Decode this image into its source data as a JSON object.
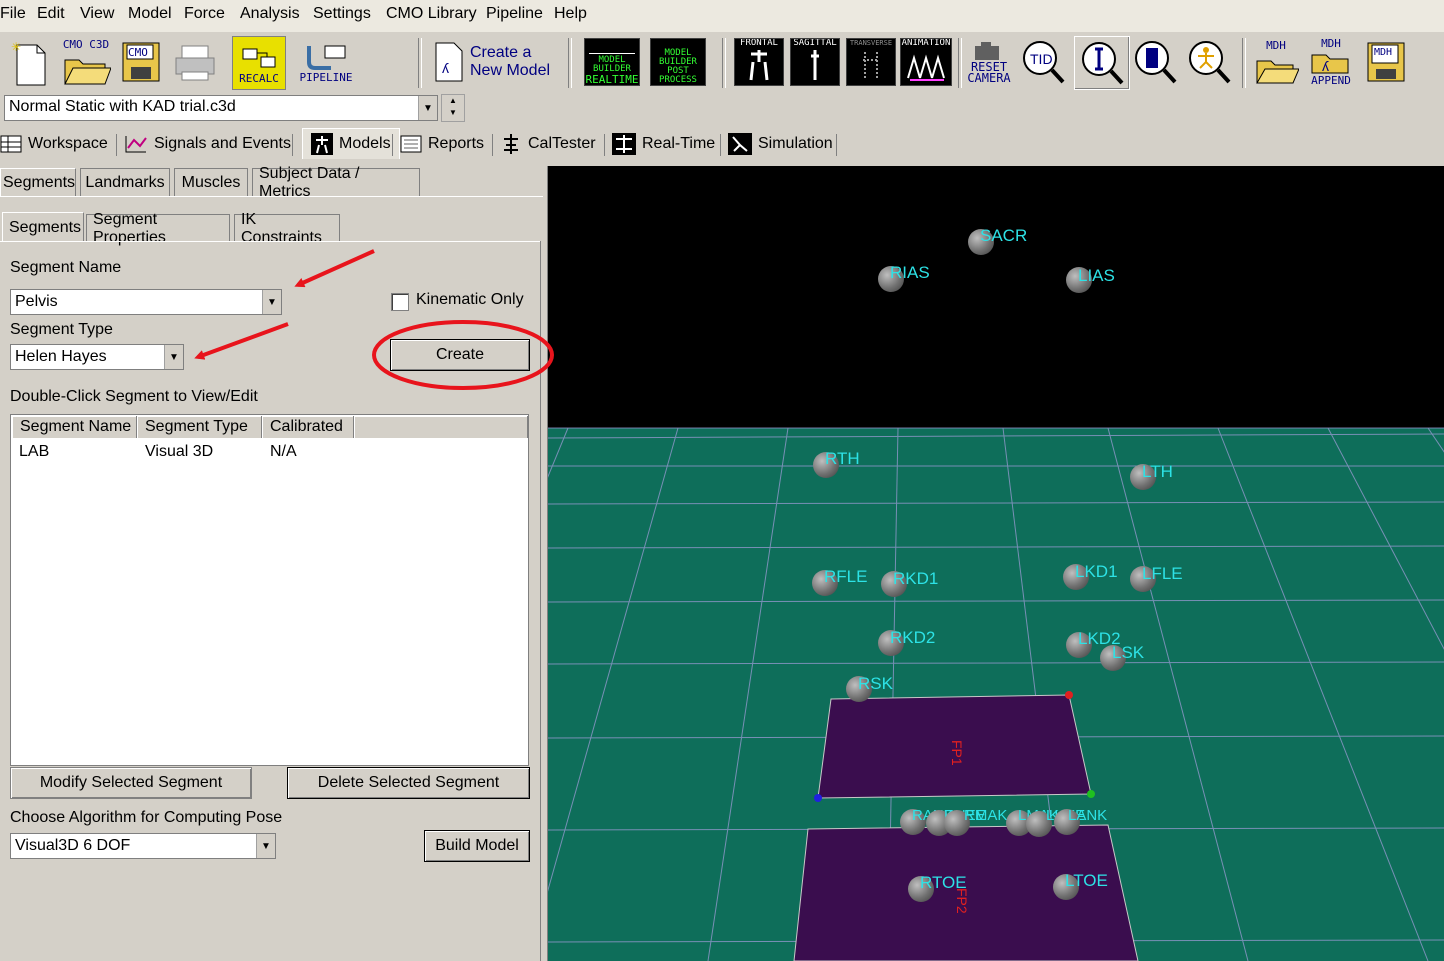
{
  "menu": [
    "File",
    "Edit",
    "View",
    "Model",
    "Force",
    "Analysis",
    "Settings",
    "CMO Library",
    "Pipeline",
    "Help"
  ],
  "toolbar": {
    "cmo_c3d": "CMO C3D",
    "cmo": "CMO",
    "recalc": "RECALC",
    "pipeline": "PIPELINE",
    "create_model_line1": "Create a",
    "create_model_line2": "New Model",
    "mb_realtime": [
      "MODEL",
      "BUILDER",
      "REALTIME"
    ],
    "mb_post": [
      "MODEL",
      "BUILDER",
      "POST",
      "PROCESS"
    ],
    "frontal": "FRONTAL",
    "sagittal": "SAGITTAL",
    "transverse": "TRANSVERSE",
    "animation": "ANIMATION",
    "reset_camera_1": "RESET",
    "reset_camera_2": "CAMERA",
    "mdh1": "MDH",
    "mdh_append": "MDH",
    "append": "APPEND",
    "mdh3": "MDH"
  },
  "file_combo": {
    "value": "Normal Static with KAD trial.c3d"
  },
  "main_tabs": [
    "Workspace",
    "Signals and Events",
    "Models",
    "Reports",
    "CalTester",
    "Real-Time",
    "Simulation"
  ],
  "sub_tabs": [
    "Segments",
    "Landmarks",
    "Muscles",
    "Subject Data / Metrics"
  ],
  "inner_tabs": [
    "Segments",
    "Segment Properties",
    "IK Constraints"
  ],
  "form": {
    "segment_name_label": "Segment Name",
    "segment_name_value": "Pelvis",
    "kinematic_only": "Kinematic Only",
    "segment_type_label": "Segment Type",
    "segment_type_value": "Helen Hayes",
    "create": "Create",
    "list_label": "Double-Click Segment to View/Edit",
    "columns": [
      "Segment Name",
      "Segment Type",
      "Calibrated"
    ],
    "rows": [
      {
        "name": "LAB",
        "type": "Visual 3D",
        "calibrated": "N/A"
      }
    ],
    "modify": "Modify Selected Segment",
    "delete": "Delete Selected Segment",
    "algo_label": "Choose Algorithm for Computing Pose",
    "algo_value": "Visual3D 6 DOF",
    "build": "Build Model"
  },
  "markers": [
    "SACR",
    "RIAS",
    "LIAS",
    "RTH",
    "LTH",
    "RFLE",
    "RKD1",
    "LKD1",
    "LFLE",
    "RKD2",
    "LKD2",
    "LSK",
    "RSK",
    "RANK",
    "RHEE",
    "RMAK",
    "LMAK",
    "LHEE",
    "LANK",
    "RTOE",
    "LTOE"
  ],
  "force_plates": [
    "FP1",
    "FP2"
  ],
  "colors": {
    "floor": "#0e6e5a",
    "plate": "#3a0d4e",
    "marker_label": "#2de2e6",
    "annotation": "#e8141c"
  }
}
